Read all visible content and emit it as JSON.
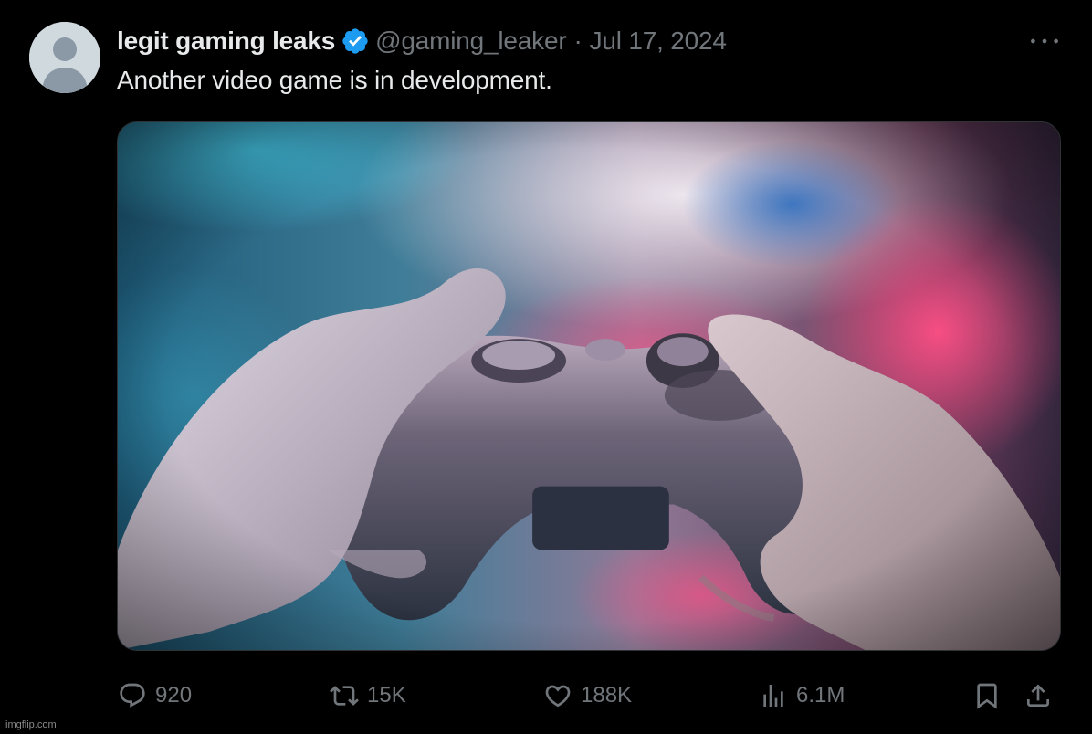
{
  "tweet": {
    "author": {
      "name": "legit gaming leaks",
      "handle": "@gaming_leaker",
      "verified": true,
      "avatar_icon": "default-avatar-icon"
    },
    "separator": "·",
    "date": "Jul 17, 2024",
    "text": "Another video game is in development.",
    "media": {
      "kind": "photo",
      "subject": "hands holding a game controller"
    },
    "actions": {
      "reply": {
        "icon": "reply-icon",
        "count": "920"
      },
      "retweet": {
        "icon": "retweet-icon",
        "count": "15K"
      },
      "like": {
        "icon": "heart-icon",
        "count": "188K"
      },
      "views": {
        "icon": "views-icon",
        "count": "6.1M"
      },
      "bookmark": {
        "icon": "bookmark-icon"
      },
      "share": {
        "icon": "share-icon"
      }
    },
    "more_icon": "more-icon"
  },
  "watermark": "imgflip.com",
  "colors": {
    "background": "#000000",
    "text_primary": "#e7e9ea",
    "text_secondary": "#71767b",
    "verified_blue": "#1d9bf0"
  }
}
